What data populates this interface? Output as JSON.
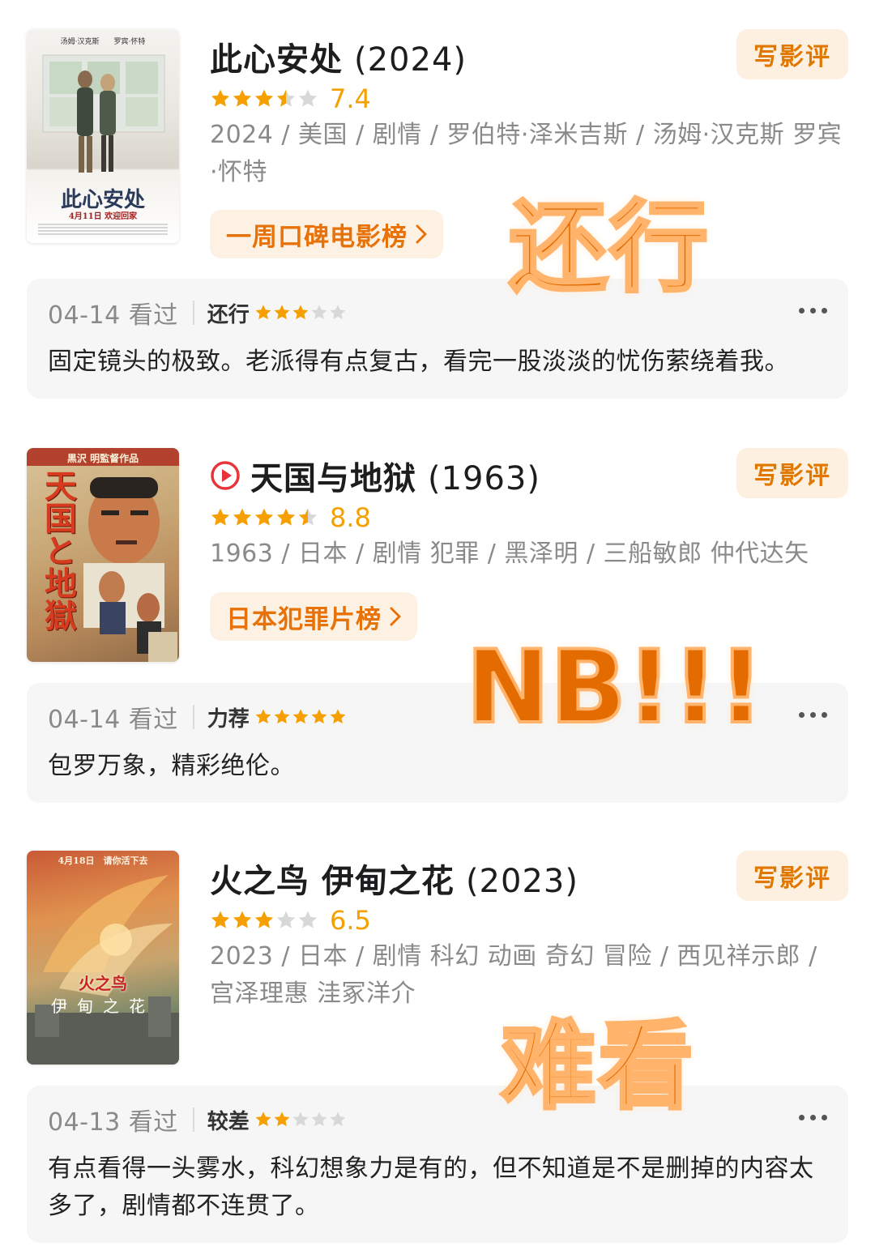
{
  "movies": [
    {
      "title": "此心安处",
      "year": "(2024)",
      "has_play_icon": false,
      "rating_stars": 3.5,
      "score": "7.4",
      "meta": "2024 / 美国 / 剧情 / 罗伯特·泽米吉斯 / 汤姆·汉克斯 罗宾·怀特",
      "chart": "一周口碑电影榜",
      "review_button": "写影评",
      "poster": {
        "top_names": "汤姆·汉克斯　　罗宾·怀特",
        "title": "此心安处",
        "date": "4月11日 欢迎回家"
      },
      "comment": {
        "date": "04-14 看过",
        "verdict": "还行",
        "stars": 3,
        "text": "固定镜头的极致。老派得有点复古，看完一股淡淡的忧伤萦绕着我。"
      },
      "sticker": "还行"
    },
    {
      "title": "天国与地狱",
      "year": "(1963)",
      "has_play_icon": true,
      "rating_stars": 4.5,
      "score": "8.8",
      "meta": "1963 / 日本 / 剧情 犯罪 / 黑泽明 / 三船敏郎 仲代达矢",
      "chart": "日本犯罪片榜",
      "review_button": "写影评",
      "poster": {
        "top_names": "黒沢 明監督作品",
        "title": "天国と地獄"
      },
      "comment": {
        "date": "04-14 看过",
        "verdict": "力荐",
        "stars": 5,
        "text": "包罗万象，精彩绝伦。"
      },
      "sticker": "NB!!!"
    },
    {
      "title": "火之鸟 伊甸之花",
      "year": "(2023)",
      "has_play_icon": false,
      "rating_stars": 3,
      "score": "6.5",
      "meta": "2023 / 日本 / 剧情 科幻 动画 奇幻 冒险 / 西见祥示郎 / 宫泽理惠 洼冢洋介",
      "chart": "",
      "review_button": "写影评",
      "poster": {
        "top_names": "4月18日　请你活下去",
        "title": "火之鸟",
        "subtitle": "伊甸之花"
      },
      "comment": {
        "date": "04-13 看过",
        "verdict": "较差",
        "stars": 2,
        "text": "有点看得一头雾水，科幻想象力是有的，但不知道是不是删掉的内容太多了，剧情都不连贯了。"
      },
      "sticker": "难看"
    }
  ],
  "colors": {
    "accent": "#e07800",
    "star": "#f5a000",
    "star_empty": "#d8d8d8",
    "play": "#e8333a",
    "card_bg": "#f6f6f6",
    "chip_bg": "#fdf1e3"
  }
}
